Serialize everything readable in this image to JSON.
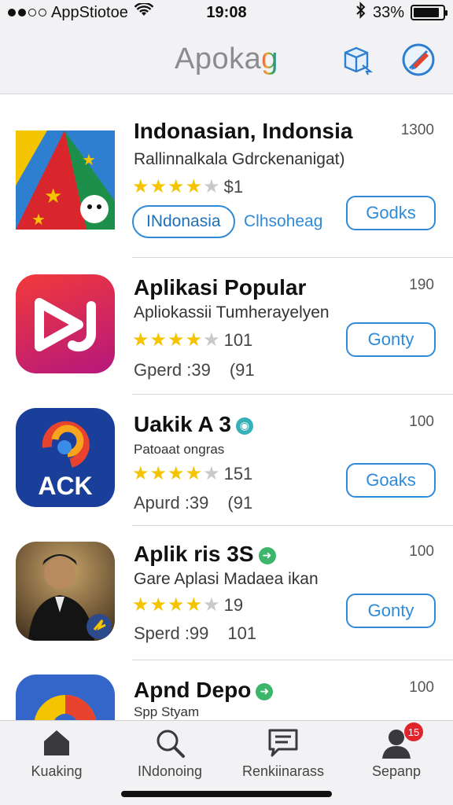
{
  "status_bar": {
    "carrier": "AppStiotoe",
    "time": "19:08",
    "battery": "33%",
    "battery_level": 0.9
  },
  "nav": {
    "title_main": "Apoka",
    "title_accent": "g",
    "icons": [
      "cube-select-icon",
      "edit-pen-icon"
    ]
  },
  "apps": [
    {
      "name": "Indonasian, Indonsia",
      "subtitle": "Rallinnalkala Gdrckenanigat)",
      "count": "1300",
      "rating": 4,
      "rating_text": "$1",
      "pill": "INdonasia",
      "link": "Clhsoheag",
      "button": "Godks"
    },
    {
      "name": "Aplikasi Popular",
      "subtitle": "Apliokassii Tumherayelyen",
      "count": "190",
      "rating": 4,
      "rating_text": "101",
      "meta_left": "Gperd :39",
      "meta_right": "(91",
      "button": "Gonty"
    },
    {
      "name": "Uakik A 3",
      "subtitle": "Patoaat ongras",
      "count": "100",
      "rating": 4,
      "rating_text": "151",
      "meta_left": "Apurd :39",
      "meta_right": "(91",
      "button": "Goaks",
      "icon_text": "ACK"
    },
    {
      "name": "Aplik ris 3S",
      "subtitle": "Gare Aplasi Madaea ikan",
      "count": "100",
      "rating": 4,
      "rating_text": "19",
      "meta_left": "Sperd :99",
      "meta_right": "101",
      "button": "Gonty"
    },
    {
      "name": "Apnd Depo",
      "subtitle": "Spp Styam",
      "count": "100"
    }
  ],
  "tabs": [
    {
      "label": "Kuaking",
      "icon": "home-icon"
    },
    {
      "label": "INdonoing",
      "icon": "search-icon"
    },
    {
      "label": "Renkiinarass",
      "icon": "chat-icon"
    },
    {
      "label": "Sepanp",
      "icon": "profile-icon",
      "badge": "15"
    }
  ]
}
